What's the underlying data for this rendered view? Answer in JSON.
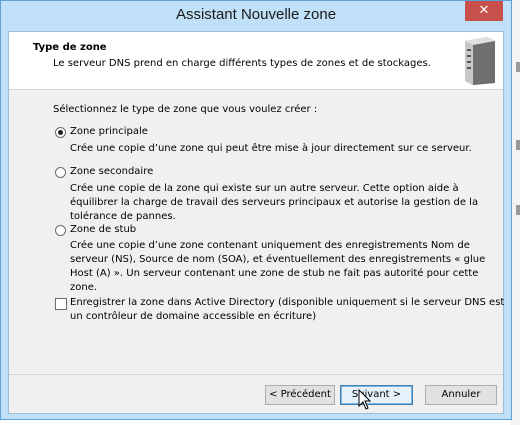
{
  "window": {
    "title": "Assistant Nouvelle zone",
    "close_glyph": "✕"
  },
  "header": {
    "title": "Type de zone",
    "subtitle": "Le serveur DNS prend en charge différents types de zones et de stockages.",
    "icon": "server-icon"
  },
  "content": {
    "prompt": "Sélectionnez le type de zone que vous voulez créer :",
    "options": [
      {
        "label": "Zone principale",
        "checked": true,
        "description": "Crée une copie d’une zone qui peut être mise à jour directement sur ce serveur."
      },
      {
        "label": "Zone secondaire",
        "checked": false,
        "description_lines": [
          "Crée une copie de la zone qui existe sur un autre serveur. Cette option aide à",
          "équilibrer la charge de travail des serveurs principaux et autorise la gestion de la",
          "tolérance de pannes."
        ]
      },
      {
        "label": "Zone de stub",
        "checked": false,
        "description_lines": [
          "Crée une copie d’une zone contenant uniquement des enregistrements Nom de",
          "serveur (NS), Source de nom (SOA), et éventuellement des enregistrements « glue",
          "Host (A) ». Un serveur contenant une zone de stub ne fait pas autorité pour cette",
          "zone."
        ]
      }
    ],
    "ad_checkbox": {
      "checked": false,
      "label_lines": [
        "Enregistrer la zone dans Active Directory (disponible uniquement si le serveur DNS est",
        "un contrôleur de domaine accessible en écriture)"
      ]
    }
  },
  "buttons": {
    "back": "< Précédent",
    "next": "Suivant >",
    "cancel": "Annuler"
  },
  "colors": {
    "frame": "#bfe0f7",
    "close": "#c7504b",
    "client": "#f0f0f0"
  }
}
